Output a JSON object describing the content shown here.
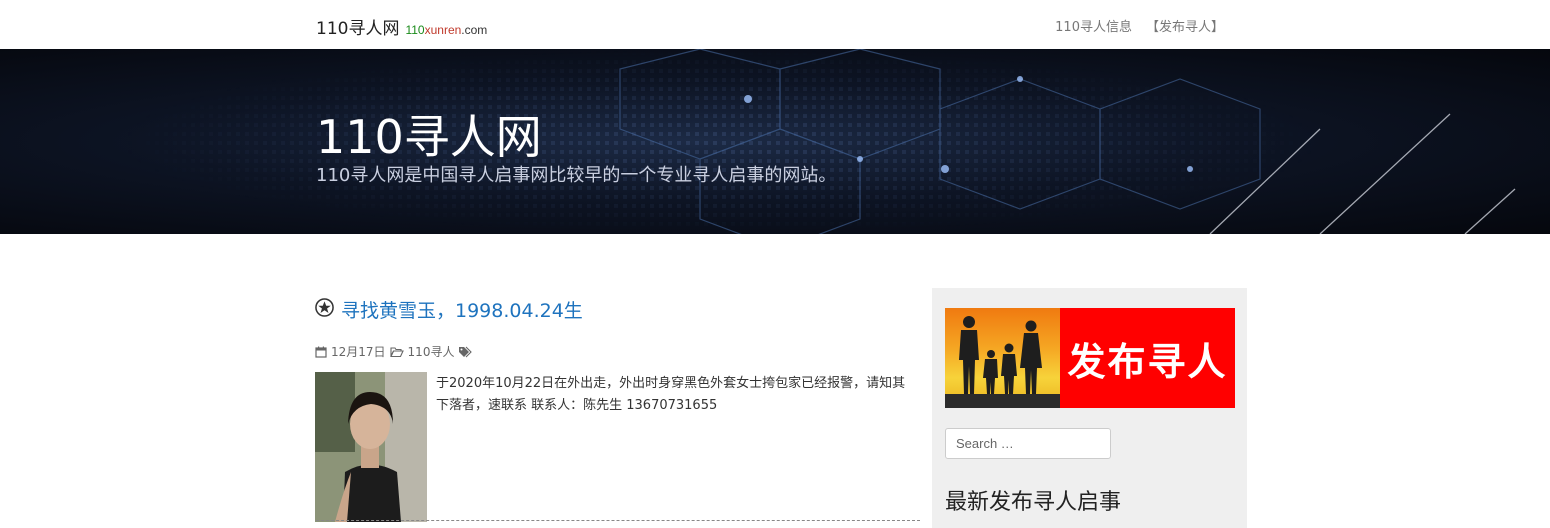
{
  "brand": {
    "name": "110寻人网",
    "domain_num": "110",
    "domain_word": "xunren",
    "domain_tld": ".com"
  },
  "nav": {
    "items": [
      {
        "label": "110寻人信息"
      },
      {
        "label": "【发布寻人】"
      }
    ]
  },
  "hero": {
    "title": "110寻人网",
    "subtitle": "110寻人网是中国寻人启事网比较早的一个专业寻人启事的网站。"
  },
  "post": {
    "title": "寻找黄雪玉，1998.04.24生",
    "date": "12月17日",
    "category": "110寻人",
    "excerpt": "于2020年10月22日在外出走，外出时身穿黑色外套女士挎包家已经报警，请知其下落者，速联系 联系人：陈先生 13670731655"
  },
  "sidebar": {
    "banner_text": "发布寻人",
    "search_placeholder": "Search …",
    "widget_title": "最新发布寻人启事"
  },
  "icons": {
    "post_format": "sticky-star-icon",
    "date": "calendar-icon",
    "category": "folder-open-icon",
    "tags": "tags-icon"
  },
  "colors": {
    "link": "#1e73be",
    "banner_red": "#ff0000"
  }
}
